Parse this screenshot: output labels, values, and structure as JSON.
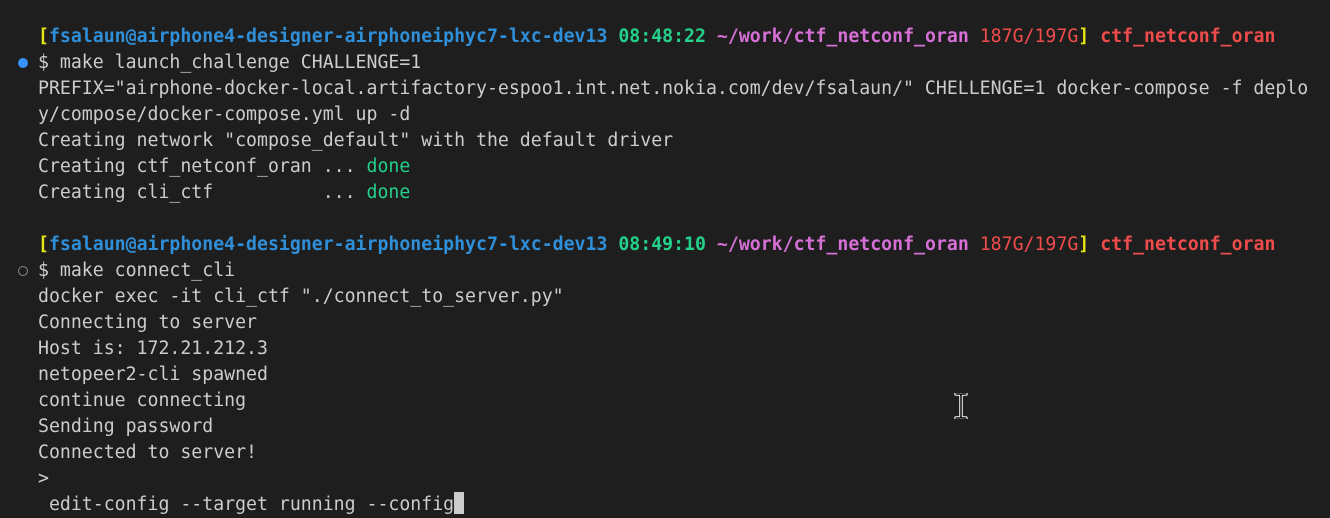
{
  "prompts": [
    {
      "open_bracket": "[",
      "user": "fsalaun",
      "at": "@",
      "host": "airphone4-designer-airphoneiphyc7-lxc-dev13",
      "time": "08:48:22",
      "path": "~/work/ctf_netconf_oran",
      "disk": "187G/197G",
      "close_bracket": "]",
      "branch": "ctf_netconf_oran"
    },
    {
      "open_bracket": "[",
      "user": "fsalaun",
      "at": "@",
      "host": "airphone4-designer-airphoneiphyc7-lxc-dev13",
      "time": "08:49:10",
      "path": "~/work/ctf_netconf_oran",
      "disk": "187G/197G",
      "close_bracket": "]",
      "branch": "ctf_netconf_oran"
    }
  ],
  "block1": {
    "command": "$ make launch_challenge CHALLENGE=1",
    "output": [
      "PREFIX=\"airphone-docker-local.artifactory-espoo1.int.net.nokia.com/dev/fsalaun/\" CHELLENGE=1 docker-compose -f deplo",
      "y/compose/docker-compose.yml up -d",
      "Creating network \"compose_default\" with the default driver"
    ],
    "creating": [
      {
        "text": "Creating ctf_netconf_oran ... ",
        "status": "done"
      },
      {
        "text": "Creating cli_ctf          ... ",
        "status": "done"
      }
    ]
  },
  "block2": {
    "command": "$ make connect_cli",
    "output": [
      "docker exec -it cli_ctf \"./connect_to_server.py\"",
      "Connecting to server",
      "Host is: 172.21.212.3",
      "netopeer2-cli spawned",
      "continue connecting",
      "Sending password",
      "Connected to server!",
      ">"
    ],
    "input_line": " edit-config --target running --config"
  },
  "colors": {
    "background": "#1e1e1e",
    "foreground": "#cccccc",
    "user": "#2f8fd8",
    "bracket": "#e5e510",
    "time": "#23d18b",
    "path": "#d670d6",
    "disk": "#f14c4c",
    "branch": "#f14c4c",
    "status_done": "#23d18b",
    "decoration_success": "#3794ff"
  },
  "icons": {
    "command_success": "blue-dot-icon",
    "command_pending": "hollow-circle-icon",
    "mouse_pointer": "text-ibeam-cursor-icon"
  }
}
